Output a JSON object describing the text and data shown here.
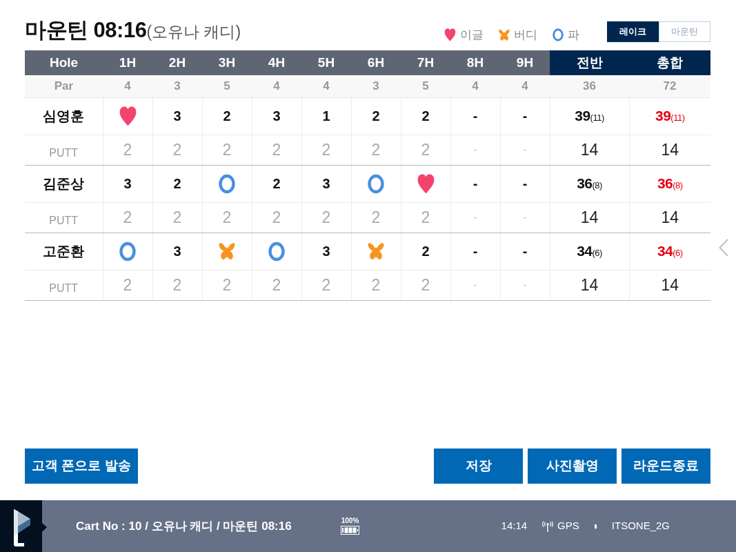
{
  "header": {
    "title": "마운틴 08:16",
    "subtitle": "(오유나 캐디)"
  },
  "legend": [
    {
      "kind": "eagle",
      "label": "이글"
    },
    {
      "kind": "birdie",
      "label": "버디"
    },
    {
      "kind": "par",
      "label": "파"
    }
  ],
  "course_tabs": [
    {
      "label": "레이크",
      "selected": true
    },
    {
      "label": "마운틴",
      "selected": false
    }
  ],
  "scorecard": {
    "columns": [
      {
        "label": "Hole",
        "kind": "label"
      },
      {
        "label": "1H",
        "kind": "hole"
      },
      {
        "label": "2H",
        "kind": "hole"
      },
      {
        "label": "3H",
        "kind": "hole"
      },
      {
        "label": "4H",
        "kind": "hole"
      },
      {
        "label": "5H",
        "kind": "hole"
      },
      {
        "label": "6H",
        "kind": "hole"
      },
      {
        "label": "7H",
        "kind": "hole"
      },
      {
        "label": "8H",
        "kind": "hole"
      },
      {
        "label": "9H",
        "kind": "hole"
      },
      {
        "label": "전반",
        "kind": "subtotal"
      },
      {
        "label": "총합",
        "kind": "total"
      }
    ],
    "par": {
      "label": "Par",
      "values": [
        "4",
        "3",
        "5",
        "4",
        "4",
        "3",
        "5",
        "4",
        "4",
        "36",
        "72"
      ]
    },
    "players": [
      {
        "name": "심영훈",
        "scores": [
          {
            "kind": "eagle"
          },
          {
            "kind": "text",
            "text": "3"
          },
          {
            "kind": "text",
            "text": "2"
          },
          {
            "kind": "text",
            "text": "3"
          },
          {
            "kind": "text",
            "text": "1"
          },
          {
            "kind": "text",
            "text": "2"
          },
          {
            "kind": "text",
            "text": "2"
          },
          {
            "kind": "text",
            "text": "-"
          },
          {
            "kind": "text",
            "text": "-"
          }
        ],
        "totals": [
          {
            "score": "39",
            "over": "(11)"
          },
          {
            "score": "39",
            "over": "(11)"
          }
        ],
        "putt": {
          "label": "PUTT",
          "values": [
            "2",
            "2",
            "2",
            "2",
            "2",
            "2",
            "2",
            "-",
            "-",
            "14",
            "14"
          ]
        }
      },
      {
        "name": "김준상",
        "scores": [
          {
            "kind": "text",
            "text": "3"
          },
          {
            "kind": "text",
            "text": "2"
          },
          {
            "kind": "par"
          },
          {
            "kind": "text",
            "text": "2"
          },
          {
            "kind": "text",
            "text": "3"
          },
          {
            "kind": "par"
          },
          {
            "kind": "eagle"
          },
          {
            "kind": "text",
            "text": "-"
          },
          {
            "kind": "text",
            "text": "-"
          }
        ],
        "totals": [
          {
            "score": "36",
            "over": "(8)"
          },
          {
            "score": "36",
            "over": "(8)"
          }
        ],
        "putt": {
          "label": "PUTT",
          "values": [
            "2",
            "2",
            "2",
            "2",
            "2",
            "2",
            "2",
            "-",
            "-",
            "14",
            "14"
          ]
        }
      },
      {
        "name": "고준환",
        "scores": [
          {
            "kind": "par"
          },
          {
            "kind": "text",
            "text": "3"
          },
          {
            "kind": "birdie"
          },
          {
            "kind": "par"
          },
          {
            "kind": "text",
            "text": "3"
          },
          {
            "kind": "birdie"
          },
          {
            "kind": "text",
            "text": "2"
          },
          {
            "kind": "text",
            "text": "-"
          },
          {
            "kind": "text",
            "text": "-"
          }
        ],
        "totals": [
          {
            "score": "34",
            "over": "(6)"
          },
          {
            "score": "34",
            "over": "(6)"
          }
        ],
        "putt": {
          "label": "PUTT",
          "values": [
            "2",
            "2",
            "2",
            "2",
            "2",
            "2",
            "2",
            "-",
            "-",
            "14",
            "14"
          ]
        }
      }
    ]
  },
  "actions": {
    "left": [
      "고객 폰으로 발송"
    ],
    "right": [
      "저장",
      "사진촬영",
      "라운드종료"
    ]
  },
  "status_bar": {
    "cart_info": "Cart No : 10 / 오유나 캐디 / 마운틴 08:16",
    "battery": "100%",
    "time": "14:14",
    "gps": "GPS",
    "network": "ITSONE_2G"
  }
}
